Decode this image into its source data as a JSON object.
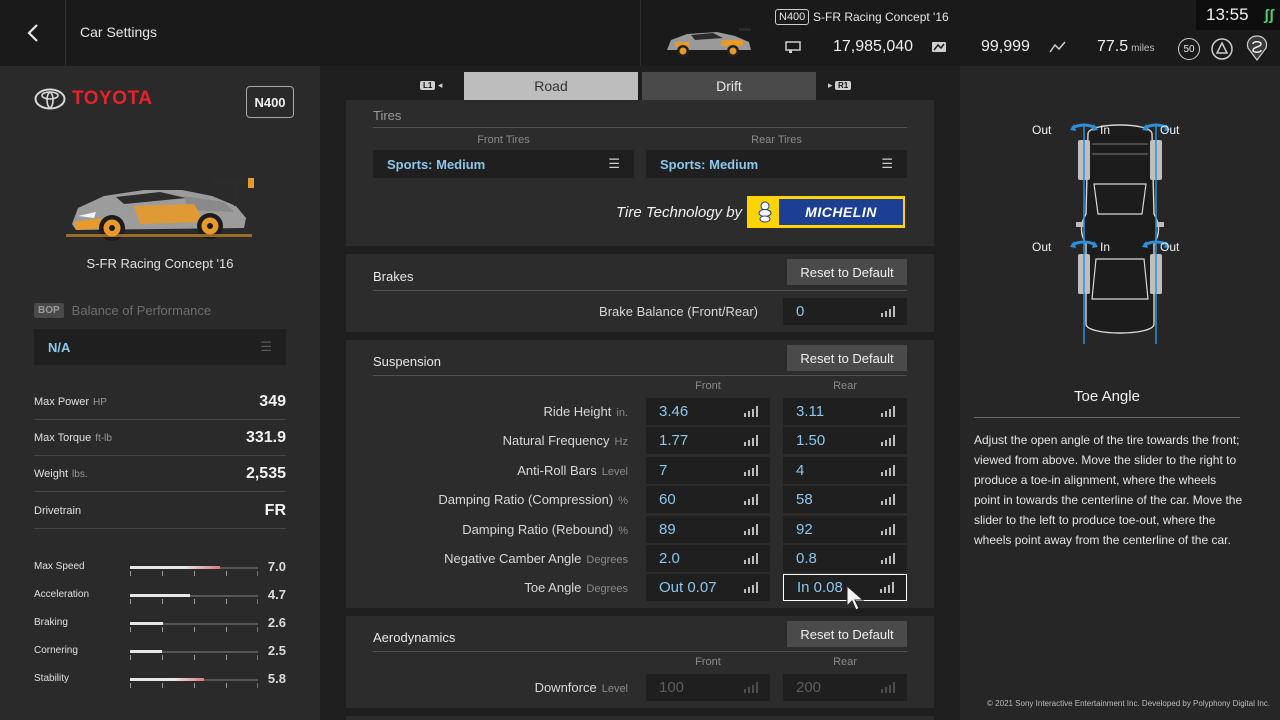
{
  "header": {
    "title": "Car Settings",
    "car_class": "N400",
    "car_name": "S-FR Racing Concept '16",
    "credits": "17,985,040",
    "mileage_points": "99,999",
    "distance": "77.5",
    "distance_unit": "miles",
    "level": "50",
    "time": "13:55"
  },
  "left": {
    "brand": "TOYOTA",
    "class_badge": "N400",
    "car_name": "S-FR Racing Concept '16",
    "bop_tag": "BOP",
    "bop_label": "Balance of Performance",
    "bop_value": "N/A",
    "specs": [
      {
        "label": "Max Power",
        "unit": "HP",
        "value": "349"
      },
      {
        "label": "Max Torque",
        "unit": "ft-lb",
        "value": "331.9"
      },
      {
        "label": "Weight",
        "unit": "lbs.",
        "value": "2,535"
      },
      {
        "label": "Drivetrain",
        "unit": "",
        "value": "FR"
      }
    ],
    "performance": [
      {
        "label": "Max Speed",
        "value": "7.0",
        "level": 0.7
      },
      {
        "label": "Acceleration",
        "value": "4.7",
        "level": 0.47
      },
      {
        "label": "Braking",
        "value": "2.6",
        "level": 0.26
      },
      {
        "label": "Cornering",
        "value": "2.5",
        "level": 0.25
      },
      {
        "label": "Stability",
        "value": "5.8",
        "level": 0.58
      }
    ]
  },
  "tabs": {
    "l1": "L1",
    "r1": "R1",
    "road": "Road",
    "drift": "Drift"
  },
  "tires": {
    "title": "Tires",
    "front_head": "Front Tires",
    "rear_head": "Rear Tires",
    "front_value": "Sports: Medium",
    "rear_value": "Sports: Medium",
    "tech_by": "Tire Technology by",
    "michelin": "MICHELIN"
  },
  "brakes": {
    "title": "Brakes",
    "reset": "Reset to Default",
    "balance_label": "Brake Balance (Front/Rear)",
    "balance_value": "0"
  },
  "suspension": {
    "title": "Suspension",
    "reset": "Reset to Default",
    "front_head": "Front",
    "rear_head": "Rear",
    "rows": [
      {
        "label": "Ride Height",
        "unit": "in.",
        "front": "3.46",
        "rear": "3.11"
      },
      {
        "label": "Natural Frequency",
        "unit": "Hz",
        "front": "1.77",
        "rear": "1.50"
      },
      {
        "label": "Anti-Roll Bars",
        "unit": "Level",
        "front": "7",
        "rear": "4"
      },
      {
        "label": "Damping Ratio (Compression)",
        "unit": "%",
        "front": "60",
        "rear": "58"
      },
      {
        "label": "Damping Ratio (Rebound)",
        "unit": "%",
        "front": "89",
        "rear": "92"
      },
      {
        "label": "Negative Camber Angle",
        "unit": "Degrees",
        "front": "2.0",
        "rear": "0.8"
      },
      {
        "label": "Toe Angle",
        "unit": "Degrees",
        "front": "Out 0.07",
        "rear": "In 0.08"
      }
    ]
  },
  "aero": {
    "title": "Aerodynamics",
    "reset": "Reset to Default",
    "front_head": "Front",
    "rear_head": "Rear",
    "downforce_label": "Downforce",
    "downforce_unit": "Level",
    "front": "100",
    "rear": "200"
  },
  "help": {
    "out_label": "Out",
    "in_label": "In",
    "title": "Toe Angle",
    "text": "Adjust the open angle of the tire towards the front; viewed from above. Move the slider to the right to produce a toe-in alignment, where the wheels point in towards the centerline of the car. Move the slider to the left to produce toe-out, where the wheels point away from the centerline of the car.",
    "copyright": "© 2021 Sony Interactive Entertainment Inc. Developed by Polyphony Digital Inc."
  },
  "colors": {
    "accent_value": "#8cc7ee",
    "brand_red": "#e8222a",
    "online": "#4fd06a"
  }
}
